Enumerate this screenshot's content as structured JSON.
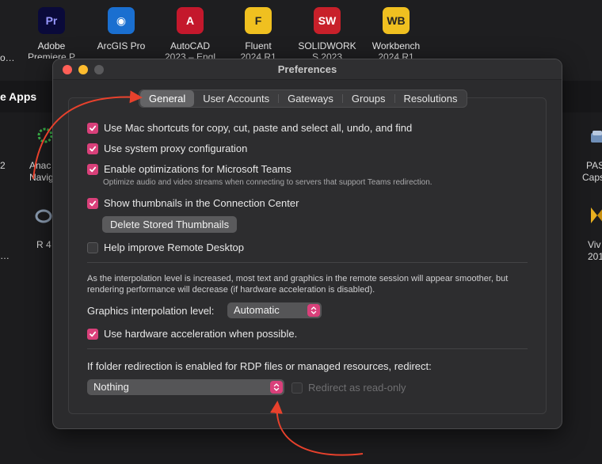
{
  "desktop": {
    "section_title": "e Apps",
    "apps": [
      {
        "label": "Adobe",
        "sub": "Premiere P",
        "icon_text": "Pr",
        "color": "#0a0a3a",
        "fg": "#9999ff"
      },
      {
        "label": "ArcGIS Pro",
        "sub": "",
        "icon_text": "◉",
        "color": "#1a6fd0",
        "fg": "#ffffff"
      },
      {
        "label": "AutoCAD",
        "sub": "2023 – Engl",
        "icon_text": "A",
        "color": "#c4182c",
        "fg": "#ffffff"
      },
      {
        "label": "Fluent",
        "sub": "2024 R1",
        "icon_text": "F",
        "color": "#f0c020",
        "fg": "#222222"
      },
      {
        "label": "SOLIDWORK",
        "sub": "S 2023",
        "icon_text": "SW",
        "color": "#c8202a",
        "fg": "#ffffff"
      },
      {
        "label": "Workbench",
        "sub": "2024 R1",
        "icon_text": "WB",
        "color": "#f0c020",
        "fg": "#222222"
      }
    ],
    "left_fragments": [
      "o…",
      "2",
      "Anac",
      "Navig",
      "R 4",
      "…"
    ],
    "right_fragments": [
      "PAS",
      "Caps",
      "Viv",
      "201"
    ]
  },
  "window": {
    "title": "Preferences",
    "tabs": [
      "General",
      "User Accounts",
      "Gateways",
      "Groups",
      "Resolutions"
    ],
    "active_tab": "General",
    "options": {
      "mac_shortcuts": "Use Mac shortcuts for copy, cut, paste and select all, undo, and find",
      "system_proxy": "Use system proxy configuration",
      "teams": "Enable optimizations for Microsoft Teams",
      "teams_hint": "Optimize audio and video streams when connecting to servers that support Teams redirection.",
      "thumbnails": "Show thumbnails in the Connection Center",
      "delete_thumbnails": "Delete Stored Thumbnails",
      "help_improve": "Help improve Remote Desktop"
    },
    "interpolation_note": "As the interpolation level is increased, most text and graphics in the remote session will appear smoother, but rendering performance will decrease (if hardware acceleration is disabled).",
    "interpolation_label": "Graphics interpolation level:",
    "interpolation_value": "Automatic",
    "hardware_accel": "Use hardware acceleration when possible.",
    "folder_note": "If folder redirection is enabled for RDP files or managed resources, redirect:",
    "folder_value": "Nothing",
    "read_only": "Redirect as read-only"
  },
  "colors": {
    "accent": "#d9407a",
    "annotation": "#e8412c"
  }
}
